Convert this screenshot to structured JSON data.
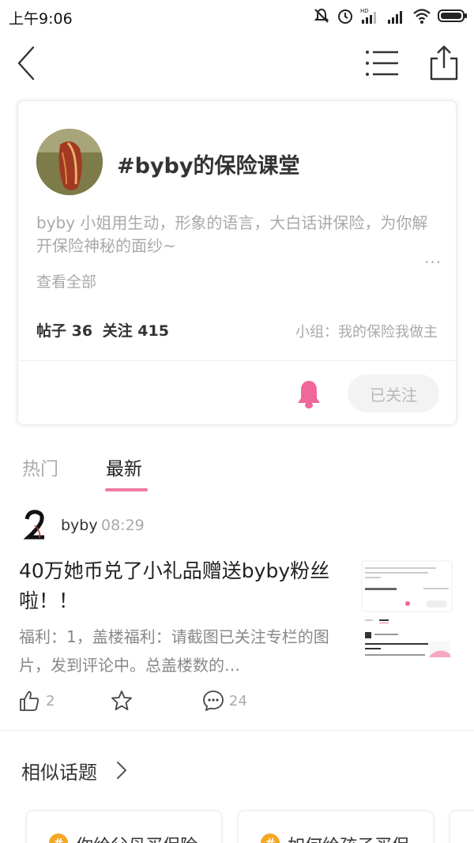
{
  "status_bar": {
    "time": "上午9:06",
    "icons": [
      "mute-icon",
      "alarm-icon",
      "hd-signal-icon",
      "signal-icon",
      "wifi-icon",
      "battery-icon"
    ]
  },
  "nav": {
    "icons": [
      "back-icon",
      "list-icon",
      "share-icon"
    ]
  },
  "topic": {
    "title": "#byby的保险课堂",
    "description": "byby 小姐用生动，形象的语言，大白话讲保险，为你解开保险神秘的面纱~",
    "more_dots": "...",
    "view_all": "查看全部",
    "posts_label": "帖子 36",
    "follows_label": "关注 415",
    "group_label": "小组：我的保险我做主",
    "followed_button": "已关注",
    "accent_color": "#f0679a"
  },
  "tabs": [
    {
      "label": "热门",
      "active": false
    },
    {
      "label": "最新",
      "active": true
    }
  ],
  "post": {
    "author": "byby",
    "time": "08:29",
    "title": "40万她币兑了小礼品赠送byby粉丝啦！！",
    "excerpt": "福利：1，盖楼福利：请截图已关注专栏的图片，发到评论中。总盖楼数的…",
    "likes": "2",
    "comments": "24"
  },
  "similar": {
    "title": "相似话题",
    "items": [
      {
        "label": "你给父母买保险"
      },
      {
        "label": "如何给孩子买保"
      }
    ]
  }
}
